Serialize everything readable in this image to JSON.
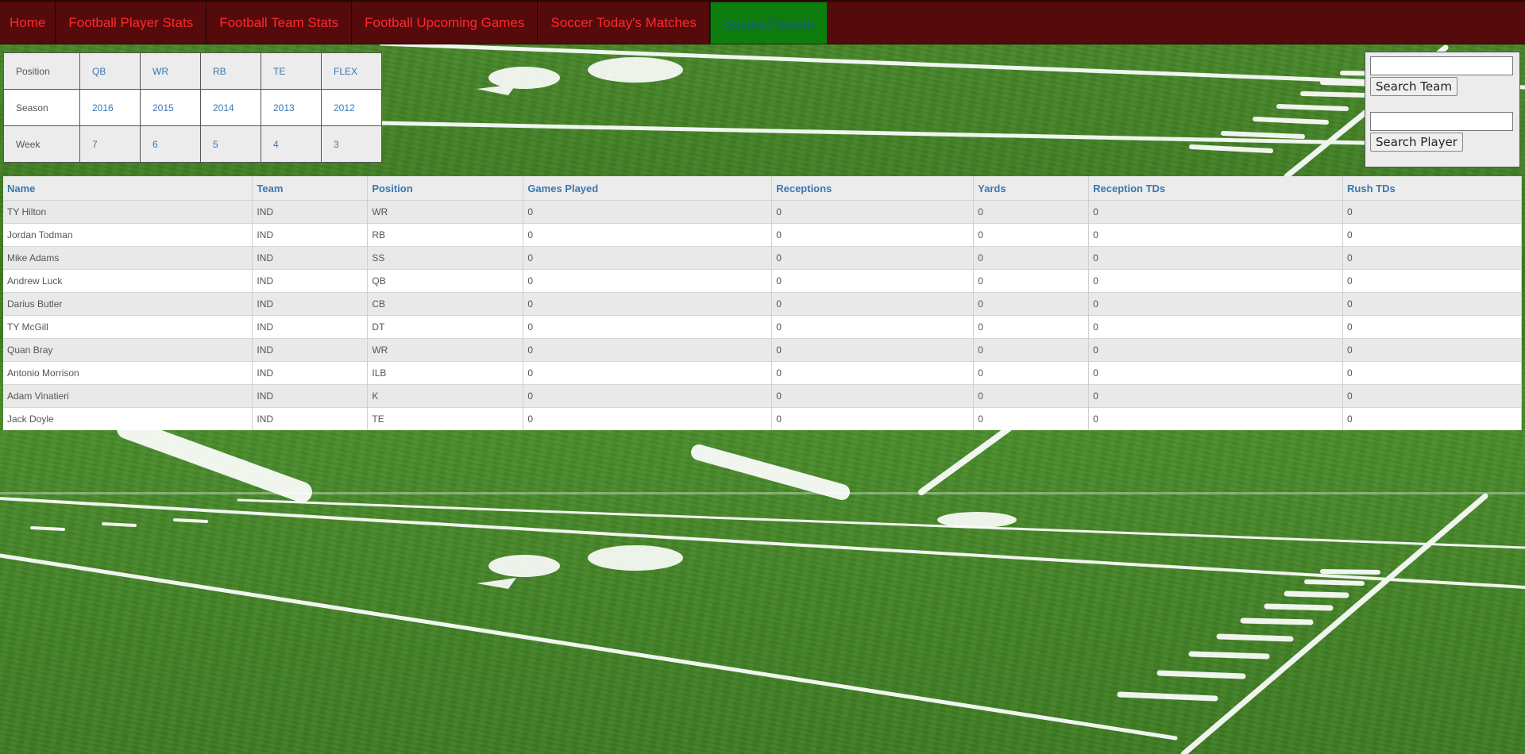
{
  "nav": {
    "items": [
      {
        "label": "Home",
        "active": false
      },
      {
        "label": "Football Player Stats",
        "active": false
      },
      {
        "label": "Football Team Stats",
        "active": false
      },
      {
        "label": "Football Upcoming Games",
        "active": false
      },
      {
        "label": "Soccer Today's Matches",
        "active": false
      },
      {
        "label": "Soccer Players",
        "active": true
      }
    ]
  },
  "filters": {
    "position": {
      "label": "Position",
      "options": [
        "QB",
        "WR",
        "RB",
        "TE",
        "FLEX"
      ]
    },
    "season": {
      "label": "Season",
      "options": [
        "2016",
        "2015",
        "2014",
        "2013",
        "2012"
      ]
    },
    "week": {
      "label": "Week",
      "options": [
        "7",
        "6",
        "5",
        "4",
        "3"
      ]
    }
  },
  "search": {
    "team": {
      "value": "",
      "button": "Search Team"
    },
    "player": {
      "value": "",
      "button": "Search Player"
    }
  },
  "stats": {
    "columns": [
      "Name",
      "Team",
      "Position",
      "Games Played",
      "Receptions",
      "Yards",
      "Reception TDs",
      "Rush TDs"
    ],
    "rows": [
      [
        "TY Hilton",
        "IND",
        "WR",
        "0",
        "0",
        "0",
        "0",
        "0"
      ],
      [
        "Jordan Todman",
        "IND",
        "RB",
        "0",
        "0",
        "0",
        "0",
        "0"
      ],
      [
        "Mike Adams",
        "IND",
        "SS",
        "0",
        "0",
        "0",
        "0",
        "0"
      ],
      [
        "Andrew Luck",
        "IND",
        "QB",
        "0",
        "0",
        "0",
        "0",
        "0"
      ],
      [
        "Darius Butler",
        "IND",
        "CB",
        "0",
        "0",
        "0",
        "0",
        "0"
      ],
      [
        "TY McGill",
        "IND",
        "DT",
        "0",
        "0",
        "0",
        "0",
        "0"
      ],
      [
        "Quan Bray",
        "IND",
        "WR",
        "0",
        "0",
        "0",
        "0",
        "0"
      ],
      [
        "Antonio Morrison",
        "IND",
        "ILB",
        "0",
        "0",
        "0",
        "0",
        "0"
      ],
      [
        "Adam Vinatieri",
        "IND",
        "K",
        "0",
        "0",
        "0",
        "0",
        "0"
      ],
      [
        "Jack Doyle",
        "IND",
        "TE",
        "0",
        "0",
        "0",
        "0",
        "0"
      ]
    ]
  },
  "colors": {
    "nav_bg": "#550a0c",
    "nav_text": "#ff2a2a",
    "nav_active_bg": "#0d7e0d",
    "link_blue": "#3a77b0"
  }
}
